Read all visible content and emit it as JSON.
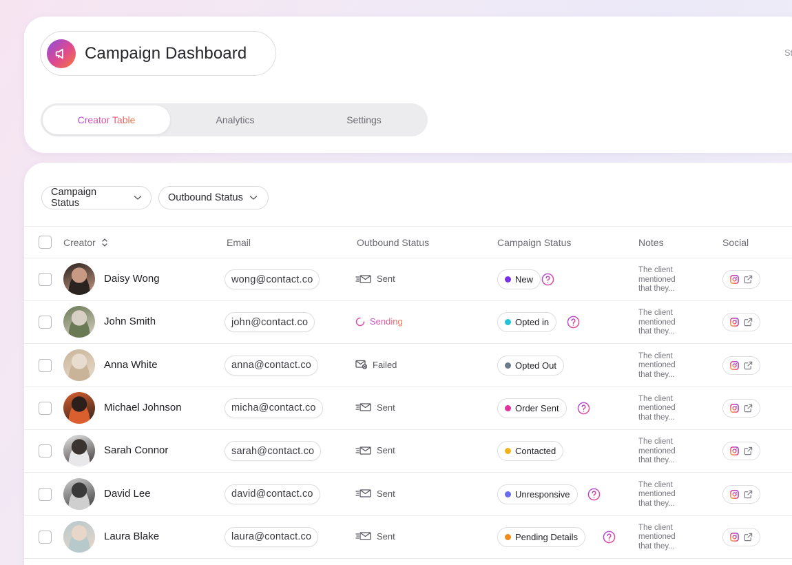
{
  "app": {
    "title": "Campaign Dashboard",
    "header_cut_text": "St"
  },
  "tabs": [
    {
      "label": "Creator Table",
      "active": true
    },
    {
      "label": "Analytics",
      "active": false
    },
    {
      "label": "Settings",
      "active": false
    }
  ],
  "filters": [
    {
      "label": "Campaign Status"
    },
    {
      "label": "Outbound Status"
    }
  ],
  "table": {
    "columns": [
      "Creator",
      "Email",
      "Outbound Status",
      "Campaign Status",
      "Notes",
      "Social"
    ],
    "rows": [
      {
        "name": "Daisy Wong",
        "email": "wong@contact.co",
        "outbound": "Sent",
        "status": "New",
        "status_color": "#7a2ee8",
        "help": true,
        "notes": "The client mentioned that they...",
        "avatar_colors": [
          "#2b2320",
          "#c89a83"
        ]
      },
      {
        "name": "John Smith",
        "email": "john@contact.co",
        "outbound": "Sending",
        "status": "Opted in",
        "status_color": "#22c4d6",
        "help": true,
        "notes": "The client mentioned that they...",
        "avatar_colors": [
          "#6a7a55",
          "#d8d0c4"
        ]
      },
      {
        "name": "Anna White",
        "email": "anna@contact.co",
        "outbound": "Failed",
        "status": "Opted Out",
        "status_color": "#6b7b8a",
        "help": false,
        "notes": "The client mentioned that they...",
        "avatar_colors": [
          "#c9b49a",
          "#e7dccd"
        ]
      },
      {
        "name": "Michael Johnson",
        "email": "micha@contact.co",
        "outbound": "Sent",
        "status": "Order Sent",
        "status_color": "#e0329a",
        "help": true,
        "notes": "The client mentioned that they...",
        "avatar_colors": [
          "#d9602e",
          "#2b1f1c"
        ]
      },
      {
        "name": "Sarah Connor",
        "email": "sarah@contact.co",
        "outbound": "Sent",
        "status": "Contacted",
        "status_color": "#f3b318",
        "help": false,
        "notes": "The client mentioned that they...",
        "avatar_colors": [
          "#e8e8ea",
          "#3a3330"
        ]
      },
      {
        "name": "David Lee",
        "email": "david@contact.co",
        "outbound": "Sent",
        "status": "Unresponsive",
        "status_color": "#6a6cf0",
        "help": true,
        "notes": "The client mentioned that they...",
        "avatar_colors": [
          "#cfcfcf",
          "#3a3a3a"
        ]
      },
      {
        "name": "Laura Blake",
        "email": "laura@contact.co",
        "outbound": "Sent",
        "status": "Pending Details",
        "status_color": "#f28a1a",
        "help": true,
        "notes": "The client mentioned that they...",
        "avatar_colors": [
          "#b8c9cc",
          "#e8d6c8"
        ]
      }
    ]
  },
  "colors": {
    "accent_start": "#8b4de0",
    "accent_mid": "#e04a8c",
    "accent_end": "#f37a3c"
  }
}
